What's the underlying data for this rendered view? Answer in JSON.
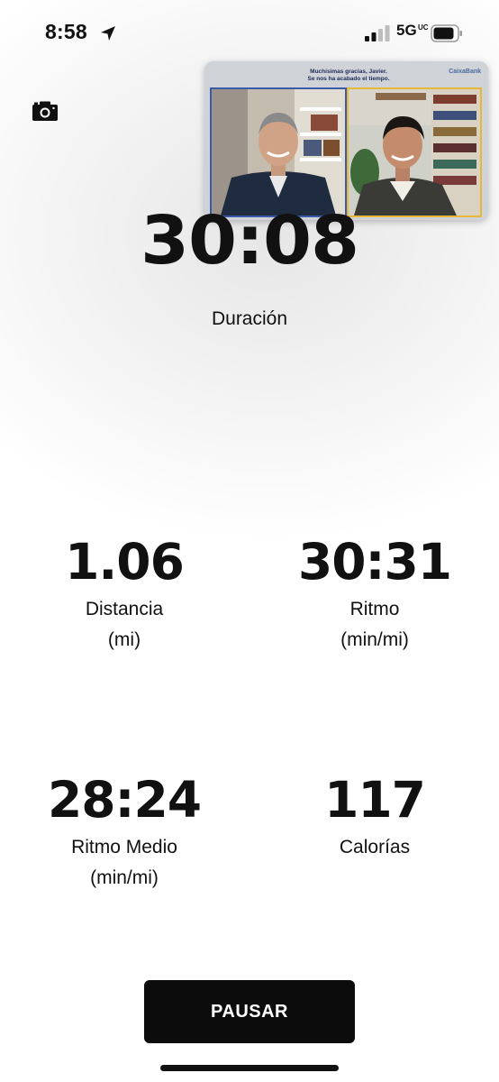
{
  "status_bar": {
    "time": "8:58",
    "network": "5G",
    "network_suffix": "UC",
    "icons": [
      "location-arrow-icon",
      "signal-icon",
      "battery-icon"
    ]
  },
  "pip": {
    "caption_line1": "Muchísimas gracias, Javier.",
    "caption_line2": "Se nos ha acabado el tiempo.",
    "brand": "CaixaBank"
  },
  "duration": {
    "value": "30:08",
    "label": "Duración"
  },
  "metrics": [
    {
      "value": "1.06",
      "label": "Distancia",
      "unit": "(mi)"
    },
    {
      "value": "30:31",
      "label": "Ritmo",
      "unit": "(min/mi)"
    },
    {
      "value": "28:24",
      "label": "Ritmo Medio",
      "unit": "(min/mi)"
    },
    {
      "value": "117",
      "label": "Calorías",
      "unit": ""
    }
  ],
  "actions": {
    "pause_label": "PAUSAR"
  },
  "colors": {
    "button": "#0c0c0c",
    "text": "#111111",
    "pip_left_border": "#3b5aa8",
    "pip_right_border": "#e7b73a"
  }
}
